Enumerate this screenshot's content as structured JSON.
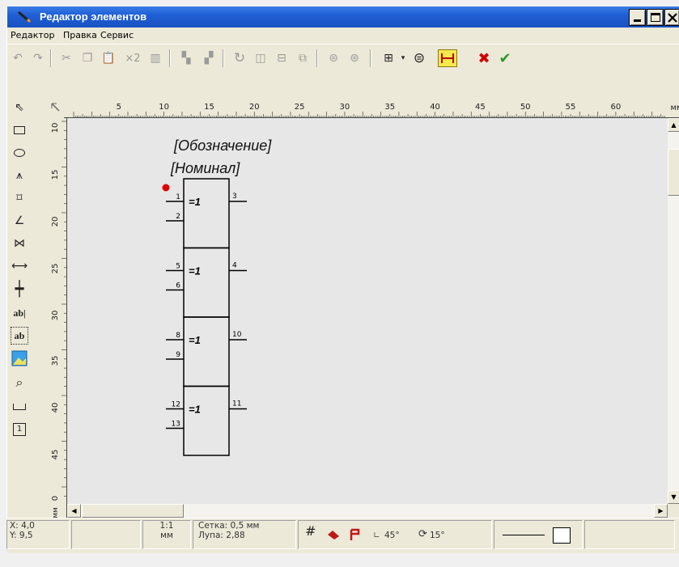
{
  "window": {
    "title": "Редактор элементов"
  },
  "menu": [
    "Редактор",
    "Правка",
    "Сервис"
  ],
  "toolbar": {
    "times_two": "×2"
  },
  "ruler": {
    "unit": "мм",
    "h_ticks": [
      "5",
      "10",
      "15",
      "20",
      "25",
      "30",
      "35",
      "40",
      "45",
      "50",
      "55",
      "60"
    ],
    "v_ticks": [
      "10",
      "15",
      "20",
      "25",
      "30",
      "35",
      "40",
      "45",
      "0"
    ]
  },
  "left_tools": {
    "text1": "ab|",
    "text2": "ab",
    "frame": "1"
  },
  "canvas": {
    "designation": "[Обозначение]",
    "nominal": "[Номинал]",
    "gate_label": "=1",
    "gates": [
      {
        "in1": "1",
        "in2": "2",
        "out": "3"
      },
      {
        "in1": "5",
        "in2": "6",
        "out": "4"
      },
      {
        "in1": "8",
        "in2": "9",
        "out": "10"
      },
      {
        "in1": "12",
        "in2": "13",
        "out": "11"
      }
    ]
  },
  "status": {
    "x": "X: 4,0",
    "y": "Y: 9,5",
    "scale": "1:1",
    "scale_unit": "мм",
    "grid": "Сетка: 0,5 мм",
    "zoom": "Лупа:  2,88",
    "angle": "45°",
    "rotate": "15°"
  },
  "colors": {
    "title_bar": "#1f5fd6",
    "canvas": "#e7e7e7",
    "pin_marker": "#e00000",
    "apply": "#2a9a2a",
    "cancel": "#d00000"
  }
}
